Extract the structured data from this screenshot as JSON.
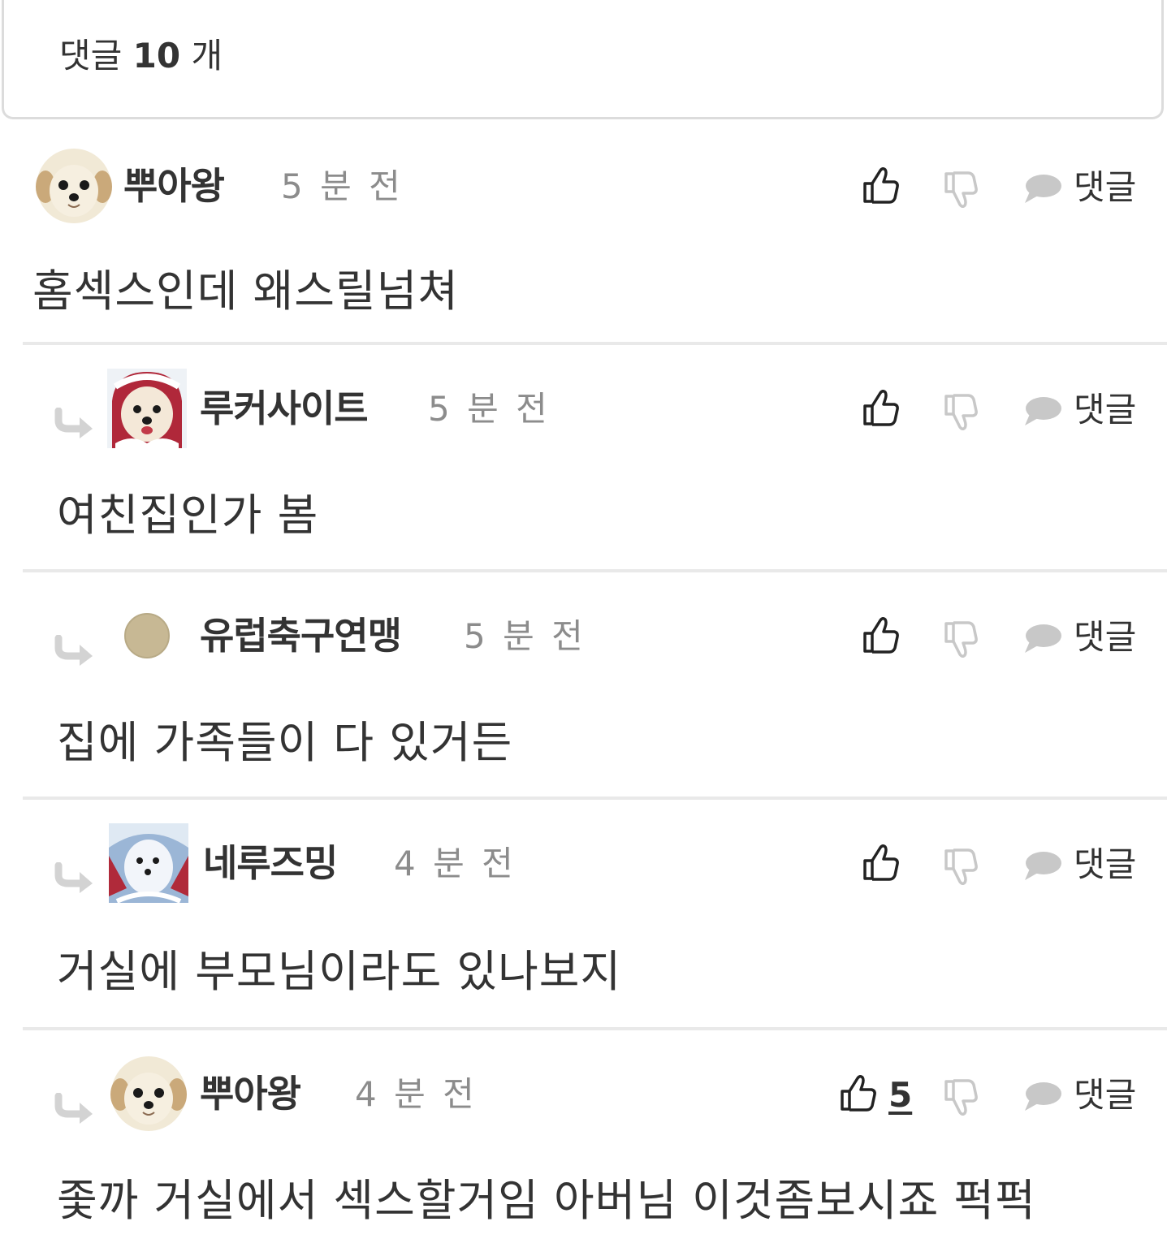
{
  "header": {
    "title_prefix": "댓글",
    "count": "10",
    "title_suffix": "개"
  },
  "actions": {
    "reply_label": "댓글"
  },
  "comments": [
    {
      "author": "뿌아왕",
      "time": "5 분 전",
      "text": "홈섹스인데 왜스릴넘쳐",
      "is_reply": false,
      "likes": "",
      "avatar": "puppy-cream"
    },
    {
      "author": "루커사이트",
      "time": "5 분 전",
      "text": "여친집인가 봄",
      "is_reply": true,
      "likes": "",
      "avatar": "puppy-red-hood"
    },
    {
      "author": "유럽축구연맹",
      "time": "5 분 전",
      "text": "집에 가족들이 다 있거든",
      "is_reply": true,
      "likes": "",
      "avatar": "circle-beige"
    },
    {
      "author": "네루즈밍",
      "time": "4 분 전",
      "text": "거실에 부모님이라도 있나보지",
      "is_reply": true,
      "likes": "",
      "avatar": "puppy-blue"
    },
    {
      "author": "뿌아왕",
      "time": "4 분 전",
      "text": "좇까 거실에서 섹스할거임 아버님 이것좀보시죠 퍽퍽",
      "is_reply": true,
      "likes": "5",
      "avatar": "puppy-cream"
    }
  ],
  "colors": {
    "text": "#333333",
    "muted": "#8c8c8c",
    "icon_light": "#c8c8c8",
    "divider": "#e9e9e9"
  },
  "icons": [
    "thumbs-up-icon",
    "thumbs-down-icon",
    "speech-bubble-icon",
    "reply-arrow-icon"
  ]
}
